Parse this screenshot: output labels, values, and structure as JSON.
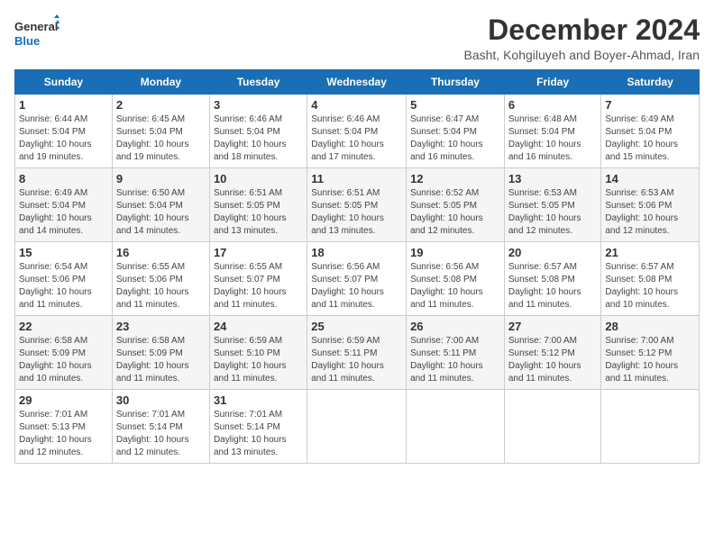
{
  "logo": {
    "line1": "General",
    "line2": "Blue"
  },
  "title": "December 2024",
  "location": "Basht, Kohgiluyeh and Boyer-Ahmad, Iran",
  "headers": [
    "Sunday",
    "Monday",
    "Tuesday",
    "Wednesday",
    "Thursday",
    "Friday",
    "Saturday"
  ],
  "weeks": [
    [
      {
        "day": "1",
        "info": "Sunrise: 6:44 AM\nSunset: 5:04 PM\nDaylight: 10 hours\nand 19 minutes."
      },
      {
        "day": "2",
        "info": "Sunrise: 6:45 AM\nSunset: 5:04 PM\nDaylight: 10 hours\nand 19 minutes."
      },
      {
        "day": "3",
        "info": "Sunrise: 6:46 AM\nSunset: 5:04 PM\nDaylight: 10 hours\nand 18 minutes."
      },
      {
        "day": "4",
        "info": "Sunrise: 6:46 AM\nSunset: 5:04 PM\nDaylight: 10 hours\nand 17 minutes."
      },
      {
        "day": "5",
        "info": "Sunrise: 6:47 AM\nSunset: 5:04 PM\nDaylight: 10 hours\nand 16 minutes."
      },
      {
        "day": "6",
        "info": "Sunrise: 6:48 AM\nSunset: 5:04 PM\nDaylight: 10 hours\nand 16 minutes."
      },
      {
        "day": "7",
        "info": "Sunrise: 6:49 AM\nSunset: 5:04 PM\nDaylight: 10 hours\nand 15 minutes."
      }
    ],
    [
      {
        "day": "8",
        "info": "Sunrise: 6:49 AM\nSunset: 5:04 PM\nDaylight: 10 hours\nand 14 minutes."
      },
      {
        "day": "9",
        "info": "Sunrise: 6:50 AM\nSunset: 5:04 PM\nDaylight: 10 hours\nand 14 minutes."
      },
      {
        "day": "10",
        "info": "Sunrise: 6:51 AM\nSunset: 5:05 PM\nDaylight: 10 hours\nand 13 minutes."
      },
      {
        "day": "11",
        "info": "Sunrise: 6:51 AM\nSunset: 5:05 PM\nDaylight: 10 hours\nand 13 minutes."
      },
      {
        "day": "12",
        "info": "Sunrise: 6:52 AM\nSunset: 5:05 PM\nDaylight: 10 hours\nand 12 minutes."
      },
      {
        "day": "13",
        "info": "Sunrise: 6:53 AM\nSunset: 5:05 PM\nDaylight: 10 hours\nand 12 minutes."
      },
      {
        "day": "14",
        "info": "Sunrise: 6:53 AM\nSunset: 5:06 PM\nDaylight: 10 hours\nand 12 minutes."
      }
    ],
    [
      {
        "day": "15",
        "info": "Sunrise: 6:54 AM\nSunset: 5:06 PM\nDaylight: 10 hours\nand 11 minutes."
      },
      {
        "day": "16",
        "info": "Sunrise: 6:55 AM\nSunset: 5:06 PM\nDaylight: 10 hours\nand 11 minutes."
      },
      {
        "day": "17",
        "info": "Sunrise: 6:55 AM\nSunset: 5:07 PM\nDaylight: 10 hours\nand 11 minutes."
      },
      {
        "day": "18",
        "info": "Sunrise: 6:56 AM\nSunset: 5:07 PM\nDaylight: 10 hours\nand 11 minutes."
      },
      {
        "day": "19",
        "info": "Sunrise: 6:56 AM\nSunset: 5:08 PM\nDaylight: 10 hours\nand 11 minutes."
      },
      {
        "day": "20",
        "info": "Sunrise: 6:57 AM\nSunset: 5:08 PM\nDaylight: 10 hours\nand 11 minutes."
      },
      {
        "day": "21",
        "info": "Sunrise: 6:57 AM\nSunset: 5:08 PM\nDaylight: 10 hours\nand 10 minutes."
      }
    ],
    [
      {
        "day": "22",
        "info": "Sunrise: 6:58 AM\nSunset: 5:09 PM\nDaylight: 10 hours\nand 10 minutes."
      },
      {
        "day": "23",
        "info": "Sunrise: 6:58 AM\nSunset: 5:09 PM\nDaylight: 10 hours\nand 11 minutes."
      },
      {
        "day": "24",
        "info": "Sunrise: 6:59 AM\nSunset: 5:10 PM\nDaylight: 10 hours\nand 11 minutes."
      },
      {
        "day": "25",
        "info": "Sunrise: 6:59 AM\nSunset: 5:11 PM\nDaylight: 10 hours\nand 11 minutes."
      },
      {
        "day": "26",
        "info": "Sunrise: 7:00 AM\nSunset: 5:11 PM\nDaylight: 10 hours\nand 11 minutes."
      },
      {
        "day": "27",
        "info": "Sunrise: 7:00 AM\nSunset: 5:12 PM\nDaylight: 10 hours\nand 11 minutes."
      },
      {
        "day": "28",
        "info": "Sunrise: 7:00 AM\nSunset: 5:12 PM\nDaylight: 10 hours\nand 11 minutes."
      }
    ],
    [
      {
        "day": "29",
        "info": "Sunrise: 7:01 AM\nSunset: 5:13 PM\nDaylight: 10 hours\nand 12 minutes."
      },
      {
        "day": "30",
        "info": "Sunrise: 7:01 AM\nSunset: 5:14 PM\nDaylight: 10 hours\nand 12 minutes."
      },
      {
        "day": "31",
        "info": "Sunrise: 7:01 AM\nSunset: 5:14 PM\nDaylight: 10 hours\nand 13 minutes."
      },
      null,
      null,
      null,
      null
    ]
  ]
}
